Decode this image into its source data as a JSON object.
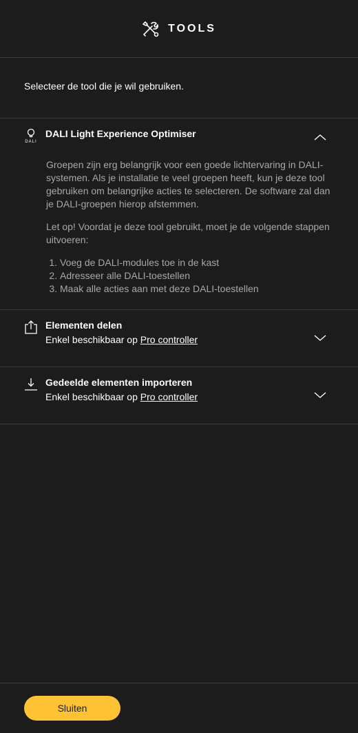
{
  "header": {
    "title": "TOOLS",
    "icon": "tools-icon"
  },
  "intro": {
    "text": "Selecteer de tool die je wil gebruiken."
  },
  "sections": {
    "dali": {
      "title": "DALI Light Experience Optimiser",
      "icon_label": "DALI",
      "expanded": true,
      "paragraph1": "Groepen zijn erg belangrijk voor een goede lichtervaring in DALI-systemen. Als je installatie te veel groepen heeft, kun je deze tool gebruiken om belangrijke acties te selecteren. De software zal dan je DALI-groepen hierop afstemmen.",
      "paragraph2": "Let op! Voordat je deze tool gebruikt, moet je de volgende stappen uitvoeren:",
      "steps": [
        "Voeg de DALI-modules toe in de kast",
        "Adresseer alle DALI-toestellen",
        "Maak alle acties aan met deze DALI-toestellen"
      ]
    },
    "share": {
      "title": "Elementen delen",
      "subtitle_prefix": "Enkel beschikbaar op",
      "link": "Pro controller",
      "expanded": false
    },
    "import": {
      "title": "Gedeelde elementen importeren",
      "subtitle_prefix": "Enkel beschikbaar op",
      "link": "Pro controller",
      "expanded": false
    }
  },
  "footer": {
    "close_label": "Sluiten"
  },
  "colors": {
    "background": "#1c1c1c",
    "accent": "#fec335",
    "divider": "#3c3c3c",
    "muted_text": "#a8a8a8"
  }
}
